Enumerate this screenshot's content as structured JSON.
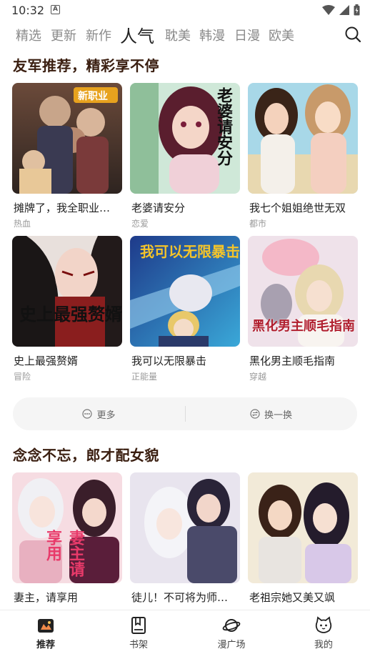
{
  "status_bar": {
    "time": "10:32",
    "notification_letter": "A"
  },
  "tabs": [
    {
      "label": "精选",
      "active": false
    },
    {
      "label": "更新",
      "active": false
    },
    {
      "label": "新作",
      "active": false
    },
    {
      "label": "人气",
      "active": true
    },
    {
      "label": "耽美",
      "active": false
    },
    {
      "label": "韩漫",
      "active": false
    },
    {
      "label": "日漫",
      "active": false
    },
    {
      "label": "欧美",
      "active": false
    }
  ],
  "section1": {
    "title": "友军推荐，精彩享不停",
    "items": [
      {
        "title": "摊牌了，我全职业…",
        "tag": "热血",
        "cover_text": "新职业"
      },
      {
        "title": "老婆请安分",
        "tag": "恋爱",
        "cover_text": "老婆请安分"
      },
      {
        "title": "我七个姐姐绝世无双",
        "tag": "都市",
        "cover_text": ""
      },
      {
        "title": "史上最强赘婿",
        "tag": "冒险",
        "cover_text": "史上最强赘婿"
      },
      {
        "title": "我可以无限暴击",
        "tag": "正能量",
        "cover_text": "我可以无限暴击"
      },
      {
        "title": "黑化男主顺毛指南",
        "tag": "穿越",
        "cover_text": "黑化男主顺毛指南"
      }
    ]
  },
  "actions": {
    "more_label": "更多",
    "refresh_label": "换一换"
  },
  "section2": {
    "title": "念念不忘，郎才配女貌",
    "items": [
      {
        "title": "妻主，请享用",
        "cover_text": "妻主请享用"
      },
      {
        "title": "徒儿！不可将为师…",
        "cover_text": ""
      },
      {
        "title": "老祖宗她又美又飒",
        "cover_text": ""
      }
    ]
  },
  "bottom_nav": [
    {
      "label": "推荐",
      "icon": "recommend-icon",
      "active": true
    },
    {
      "label": "书架",
      "icon": "bookshelf-icon",
      "active": false
    },
    {
      "label": "漫广场",
      "icon": "planet-icon",
      "active": false
    },
    {
      "label": "我的",
      "icon": "cat-face-icon",
      "active": false
    }
  ],
  "colors": {
    "accent_title": "#3a1e10",
    "title_highlight": "#f3d6c4",
    "inactive_tab": "#8a8a8a"
  }
}
